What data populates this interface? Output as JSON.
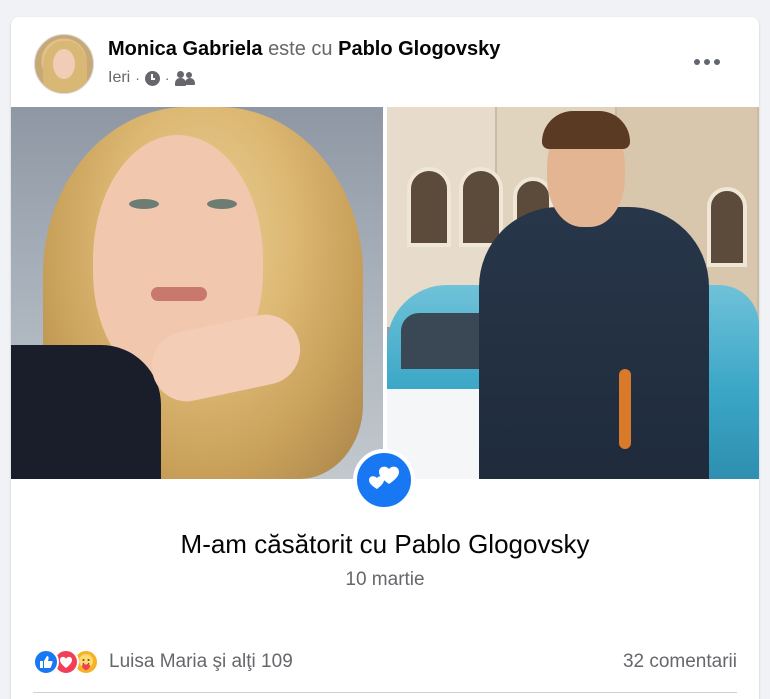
{
  "post": {
    "author": "Monica Gabriela",
    "connector": "este cu",
    "tagged": "Pablo Glogovsky",
    "time": "Ieri",
    "separator": "·",
    "icons": [
      "clock-icon",
      "friends-audience-icon",
      "more-options-icon"
    ]
  },
  "life_event": {
    "icon": "hearts-icon",
    "title": "M-am căsătorit cu Pablo Glogovsky",
    "date": "10 martie"
  },
  "engagement": {
    "reaction_icons": [
      "like-reaction-icon",
      "love-reaction-icon",
      "care-reaction-icon"
    ],
    "reactors_text": "Luisa Maria şi alţi 109",
    "comments_text": "32 comentarii"
  },
  "colors": {
    "accent": "#1877f2",
    "secondary_text": "#65676b",
    "primary_text": "#050505",
    "background": "#f0f2f5"
  }
}
